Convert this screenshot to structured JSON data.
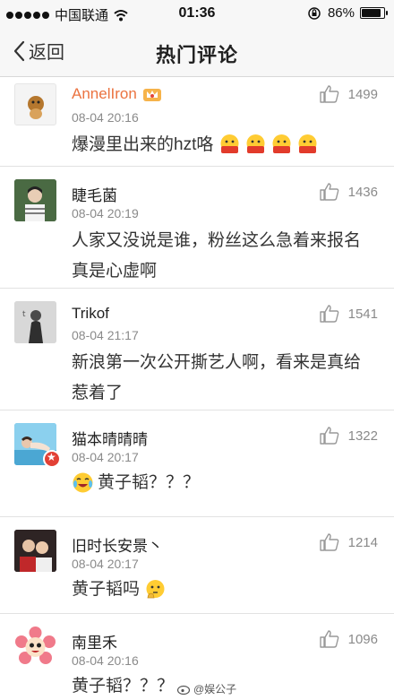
{
  "status_bar": {
    "carrier": "中国联通",
    "time": "01:36",
    "battery": "86%",
    "battery_level": 0.86
  },
  "nav": {
    "back_label": "返回",
    "title": "热门评论"
  },
  "comments": [
    {
      "name": "AnnelIron",
      "time": "08-04 20:16",
      "likes": "1499",
      "content": "爆漫里出来的hzt咯"
    },
    {
      "name": "睫毛菌",
      "time": "08-04 20:19",
      "likes": "1436",
      "content": "人家又没说是谁，粉丝这么急着来报名真是心虚啊"
    },
    {
      "name": "Trikof",
      "time": "08-04 21:17",
      "likes": "1541",
      "content": "新浪第一次公开撕艺人啊，看来是真给惹着了"
    },
    {
      "name": "猫本晴晴晴",
      "time": "08-04 20:17",
      "likes": "1322",
      "content": "黄子韬？？？"
    },
    {
      "name": "旧时长安景丶",
      "time": "08-04 20:17",
      "likes": "1214",
      "content": "黄子韬吗"
    },
    {
      "name": "南里禾",
      "time": "08-04 20:16",
      "likes": "1096",
      "content": "黄子韬？？？"
    }
  ],
  "watermark": "@娱公子"
}
